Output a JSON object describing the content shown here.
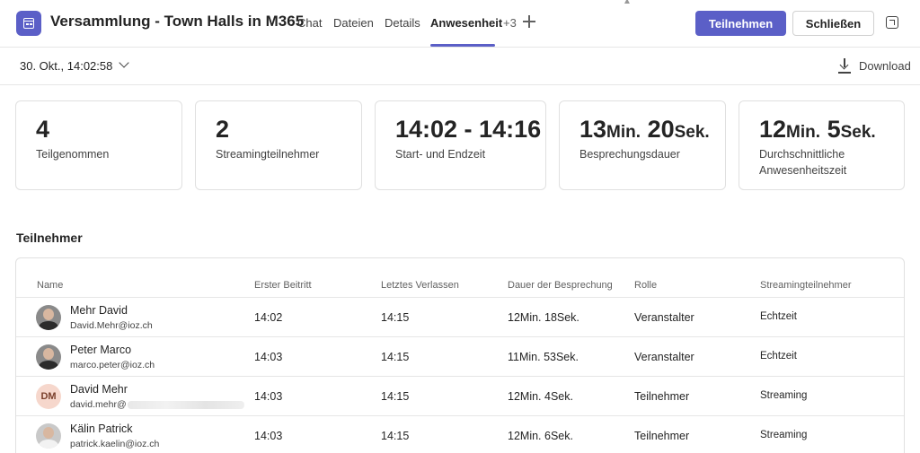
{
  "header": {
    "title": "Versammlung - Town Halls in M365",
    "tabs": [
      {
        "label": "Chat"
      },
      {
        "label": "Dateien"
      },
      {
        "label": "Details"
      },
      {
        "label": "Anwesenheit",
        "active": true
      }
    ],
    "more_tabs": "+3",
    "join_label": "Teilnehmen",
    "close_label": "Schließen",
    "accent_color": "#5b5fc7"
  },
  "toolbar": {
    "date_value": "30. Okt., 14:02:58",
    "download_label": "Download"
  },
  "stats": [
    {
      "value": "4",
      "label": "Teilgenommen"
    },
    {
      "value": "2",
      "label": "Streamingteilnehmer"
    },
    {
      "value": "14:02 - 14:16",
      "label": "Start- und Endzeit"
    },
    {
      "value_num1": "13",
      "unit1": "Min.",
      "value_num2": "20",
      "unit2": "Sek.",
      "label": "Besprechungsdauer"
    },
    {
      "value_num1": "12",
      "unit1": "Min.",
      "value_num2": "5",
      "unit2": "Sek.",
      "label_line1": "Durchschnittliche",
      "label_line2": "Anwesenheitszeit"
    }
  ],
  "participants_section": {
    "title": "Teilnehmer",
    "columns": [
      "Name",
      "Erster Beitritt",
      "Letztes Verlassen",
      "Dauer der Besprechung",
      "Rolle",
      "Streamingteilnehmer"
    ],
    "rows": [
      {
        "name": "Mehr David",
        "email": "David.Mehr@ioz.ch",
        "first_join": "14:02",
        "last_leave": "14:15",
        "duration": "12Min. 18Sek.",
        "role": "Veranstalter",
        "streaming": "Echtzeit",
        "avatar": "photo"
      },
      {
        "name": "Peter Marco",
        "email": "marco.peter@ioz.ch",
        "first_join": "14:03",
        "last_leave": "14:15",
        "duration": "11Min. 53Sek.",
        "role": "Veranstalter",
        "streaming": "Echtzeit",
        "avatar": "photo"
      },
      {
        "name": "David Mehr",
        "email": "david.mehr@",
        "initials": "DM",
        "first_join": "14:03",
        "last_leave": "14:15",
        "duration": "12Min. 4Sek.",
        "role": "Teilnehmer",
        "streaming": "Streaming",
        "avatar": "initials"
      },
      {
        "name": "Kälin Patrick",
        "email": "patrick.kaelin@ioz.ch",
        "first_join": "14:03",
        "last_leave": "14:15",
        "duration": "12Min. 6Sek.",
        "role": "Teilnehmer",
        "streaming": "Streaming",
        "avatar": "photo-light"
      }
    ]
  }
}
